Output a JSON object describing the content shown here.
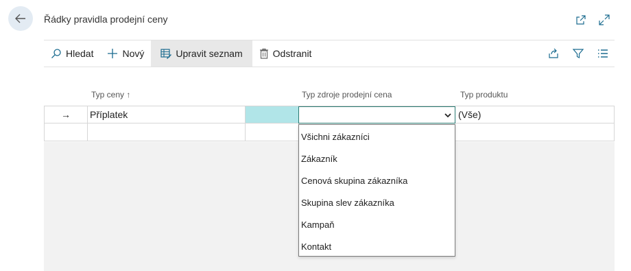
{
  "header": {
    "title": "Řádky pravidla prodejní ceny",
    "back_icon": "arrow-left-icon",
    "icons": [
      "open-in-new-window-icon",
      "expand-icon"
    ]
  },
  "toolbar": {
    "search_label": "Hledat",
    "new_label": "Nový",
    "edit_list_label": "Upravit seznam",
    "delete_label": "Odstranit",
    "right_icons": [
      "share-icon",
      "filter-icon",
      "list-view-icon"
    ]
  },
  "grid": {
    "columns": {
      "price_type": "Typ ceny",
      "price_type_sort": "↑",
      "source_type": "Typ zdroje prodejní cena",
      "product_type": "Typ produktu"
    },
    "rows": [
      {
        "indicator": "→",
        "price_type": "Příplatek",
        "source_type": "",
        "product_type": "(Vše)"
      },
      {
        "indicator": "",
        "price_type": "",
        "source_type": "",
        "product_type": ""
      }
    ]
  },
  "dropdown": {
    "options": [
      "Všichni zákazníci",
      "Zákazník",
      "Cenová skupina zákazníka",
      "Skupina slev zákazníka",
      "Kampaň",
      "Kontakt"
    ]
  },
  "colors": {
    "accent_teal": "#b1e5e8",
    "focus_border": "#2a7a72",
    "icon_blue": "#1a6b8f"
  }
}
